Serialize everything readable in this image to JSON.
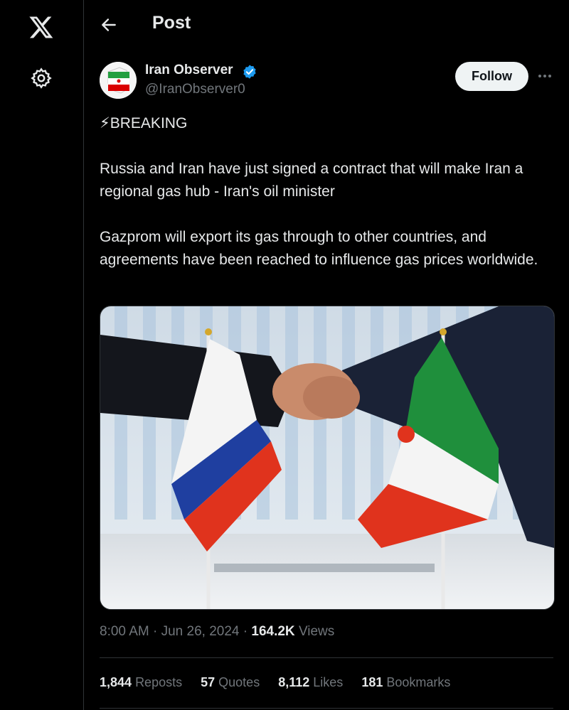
{
  "header": {
    "title": "Post"
  },
  "author": {
    "name": "Iran Observer",
    "handle": "@IranObserver0",
    "verified": true
  },
  "follow_label": "Follow",
  "post": {
    "line1": "⚡BREAKING",
    "line2": "Russia and Iran have just signed a contract that will make Iran a regional gas hub - Iran's oil minister",
    "line3": "Gazprom will export its gas through to other countries, and agreements have been reached to influence gas prices worldwide."
  },
  "meta": {
    "time": "8:00 AM",
    "date": "Jun 26, 2024",
    "views_count": "164.2K",
    "views_label": "Views"
  },
  "stats": [
    {
      "count": "1,844",
      "label": "Reposts"
    },
    {
      "count": "57",
      "label": "Quotes"
    },
    {
      "count": "8,112",
      "label": "Likes"
    },
    {
      "count": "181",
      "label": "Bookmarks"
    }
  ],
  "icons": {
    "logo": "x-logo-icon",
    "settings": "gear-icon",
    "back": "back-arrow-icon",
    "verified": "verified-badge-icon",
    "more": "more-icon"
  },
  "colors": {
    "background": "#000000",
    "text": "#e7e9ea",
    "muted": "#71767b",
    "verified": "#1d9bf0"
  }
}
